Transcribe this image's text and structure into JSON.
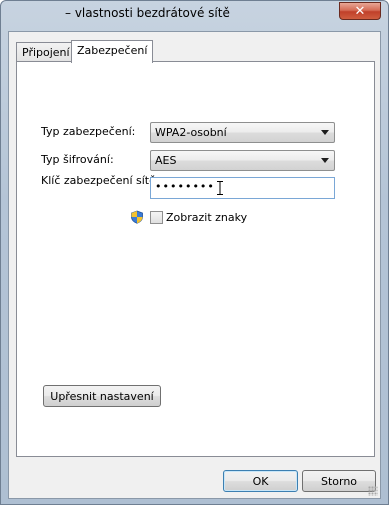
{
  "window": {
    "title": "– vlastnosti bezdrátové sítě",
    "close_label": "✕"
  },
  "tabs": [
    {
      "label": "Připojení",
      "selected": false
    },
    {
      "label": "Zabezpečení",
      "selected": true
    }
  ],
  "security": {
    "type_label": "Typ zabezpečení:",
    "type_value": "WPA2-osobní",
    "encryption_label": "Typ šifrování:",
    "encryption_value": "AES",
    "key_label": "Klíč zabezpečení sítě",
    "key_value": "••••••••",
    "show_chars_label": "Zobrazit znaky",
    "show_chars_checked": false
  },
  "buttons": {
    "advanced": "Upřesnit nastavení",
    "ok": "OK",
    "cancel": "Storno"
  },
  "colors": {
    "close_red": "#c0402a",
    "focus_blue": "#7aa7d6"
  }
}
